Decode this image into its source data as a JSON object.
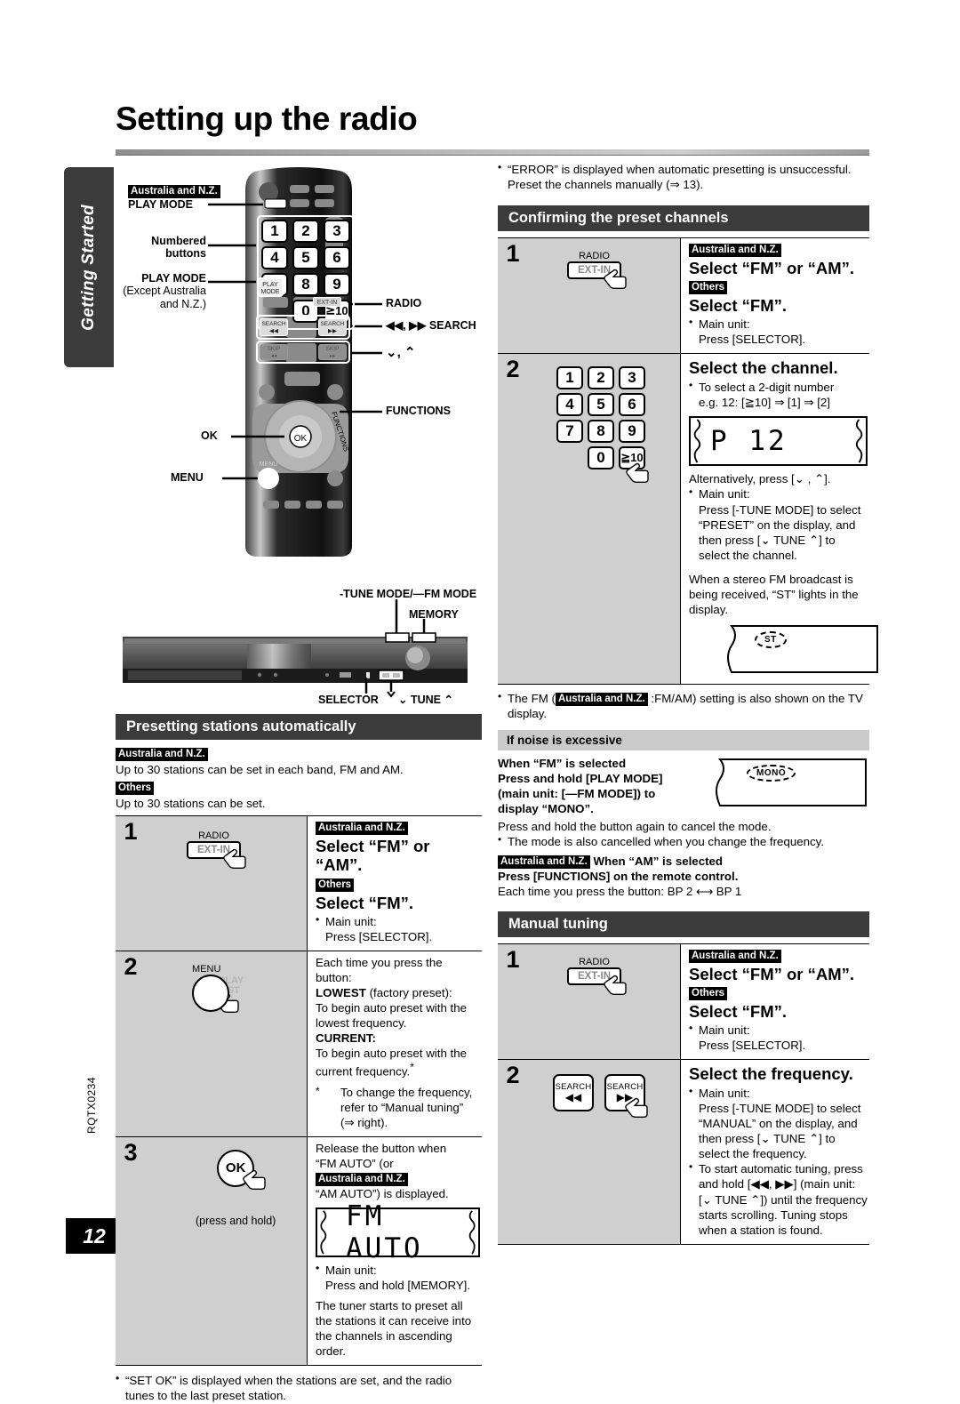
{
  "page": {
    "title": "Setting up the radio",
    "side_tab": "Getting Started",
    "page_number": "12",
    "doc_code": "RQTX0234"
  },
  "tags": {
    "anz": "Australia and N.Z.",
    "others": "Others"
  },
  "remote": {
    "labels": {
      "play_mode_anz": "PLAY MODE",
      "numbered_buttons": "Numbered\nbuttons",
      "play_mode_other": "PLAY MODE",
      "play_mode_other_sub": "(Except Australia\nand N.Z.)",
      "radio": "RADIO",
      "search": "◀◀, ▶▶ SEARCH",
      "updown": "⌄, ⌃",
      "functions": "FUNCTIONS",
      "ok": "OK",
      "menu": "MENU"
    },
    "keys": [
      "1",
      "2",
      "3",
      "4",
      "5",
      "6",
      "7",
      "8",
      "9",
      "0",
      "≧10"
    ],
    "play_mode_key": "PLAY\nMODE",
    "ext_in_key": "EXT-IN",
    "search_key": "SEARCH",
    "skip_key": "SKIP",
    "functions_text": "FUNCTIONS",
    "ok_text": "OK",
    "menu_text": "MENU"
  },
  "unit": {
    "labels": {
      "tune_mode": "-TUNE MODE/—FM MODE",
      "memory": "MEMORY",
      "selector": "SELECTOR",
      "tune": "⌄ TUNE ⌃"
    }
  },
  "left": {
    "section_title": "Presetting stations automatically",
    "intro_anz": "Up to 30 stations can be set in each band, FM and AM.",
    "intro_others": "Up to 30 stations can be set.",
    "steps": [
      {
        "no": "1",
        "fig_label": "RADIO",
        "fig_button": "EXT-IN",
        "headline_anz": "Select “FM” or “AM”.",
        "headline_others": "Select “FM”.",
        "note_main_unit": "Main unit:",
        "note_press": "Press [SELECTOR]."
      },
      {
        "no": "2",
        "fig_label": "MENU",
        "fig_ghost": "PLAY\nLIST",
        "line1": "Each time you press the button:",
        "lowest_label": "LOWEST",
        "lowest_rest": " (factory preset):",
        "lowest_desc": "To begin auto preset with the lowest frequency.",
        "current_label": "CURRENT:",
        "current_desc": "To begin auto preset with the current frequency.",
        "footnote": "To change the frequency, refer to “Manual tuning” (⇒ right)."
      },
      {
        "no": "3",
        "fig_button": "OK",
        "fig_caption": "(press and hold)",
        "line1": "Release the button when",
        "line2_a": "“FM AUTO” (or ",
        "line2_b": "“AM AUTO”) is displayed.",
        "lcd": "FM  AUTO",
        "note_main_unit": "Main unit:",
        "note_press": "Press and hold [MEMORY].",
        "tail": "The tuner starts to preset all the stations it can receive into the channels in ascending order."
      }
    ],
    "footer_note": "“SET OK” is displayed when the stations are set, and the radio tunes to the last preset station."
  },
  "right": {
    "top_note_l1": "“ERROR” is displayed when automatic presetting is unsuccessful.",
    "top_note_l2": "Preset the channels manually (⇒ 13).",
    "confirm": {
      "section_title": "Confirming the preset channels",
      "steps": [
        {
          "no": "1",
          "fig_label": "RADIO",
          "fig_button": "EXT-IN",
          "headline_anz": "Select “FM” or “AM”.",
          "headline_others": "Select “FM”.",
          "note_main_unit": "Main unit:",
          "note_press": "Press [SELECTOR]."
        },
        {
          "no": "2",
          "headline": "Select the channel.",
          "bullet1_l1": "To select a 2-digit number",
          "bullet1_l2": "e.g. 12: [≧10] ⇒ [1] ⇒ [2]",
          "lcd": "P    12",
          "alt_line": "Alternatively, press [⌄ , ⌃].",
          "note_main_unit": "Main unit:",
          "note_press": "Press [-TUNE MODE] to select “PRESET” on the display, and then press [⌄ TUNE ⌃] to select the channel.",
          "stereo_note": "When a stereo FM broadcast is being received, “ST” lights in the display.",
          "indicator": "ST"
        }
      ]
    },
    "fm_tv_note_a": "The FM (",
    "fm_tv_note_b": " :FM/AM) setting is also shown on the TV display.",
    "noise": {
      "sub_title": "If noise is excessive",
      "fm_l1": "When “FM” is selected",
      "fm_l2": "Press and hold [PLAY MODE]",
      "fm_l3": "(main unit: [—FM MODE]) to",
      "fm_l4": "display “MONO”.",
      "indicator": "MONO",
      "cancel_l1": "Press and hold the button again to cancel the mode.",
      "cancel_bullet": "The mode is also cancelled when you change the frequency.",
      "am_title": "When “AM” is selected",
      "am_l1": "Press [FUNCTIONS] on the remote control.",
      "am_l2": "Each time you press the button: BP 2 ⟷ BP 1"
    },
    "manual": {
      "section_title": "Manual tuning",
      "steps": [
        {
          "no": "1",
          "fig_label": "RADIO",
          "fig_button": "EXT-IN",
          "headline_anz": "Select “FM” or “AM”.",
          "headline_others": "Select “FM”.",
          "note_main_unit": "Main unit:",
          "note_press": "Press [SELECTOR]."
        },
        {
          "no": "2",
          "fig_btn1_l1": "SEARCH",
          "fig_btn1_l2": "◀◀",
          "fig_btn2_l1": "SEARCH",
          "fig_btn2_l2": "▶▶",
          "headline": "Select the frequency.",
          "note_main_unit": "Main unit:",
          "note_press": "Press [-TUNE MODE] to select “MANUAL” on the display, and then press [⌄ TUNE ⌃] to select the frequency.",
          "note2": "To start automatic tuning, press and hold [◀◀, ▶▶] (main unit: [⌄ TUNE ⌃]) until the frequency starts scrolling. Tuning stops when a station is found."
        }
      ]
    }
  }
}
